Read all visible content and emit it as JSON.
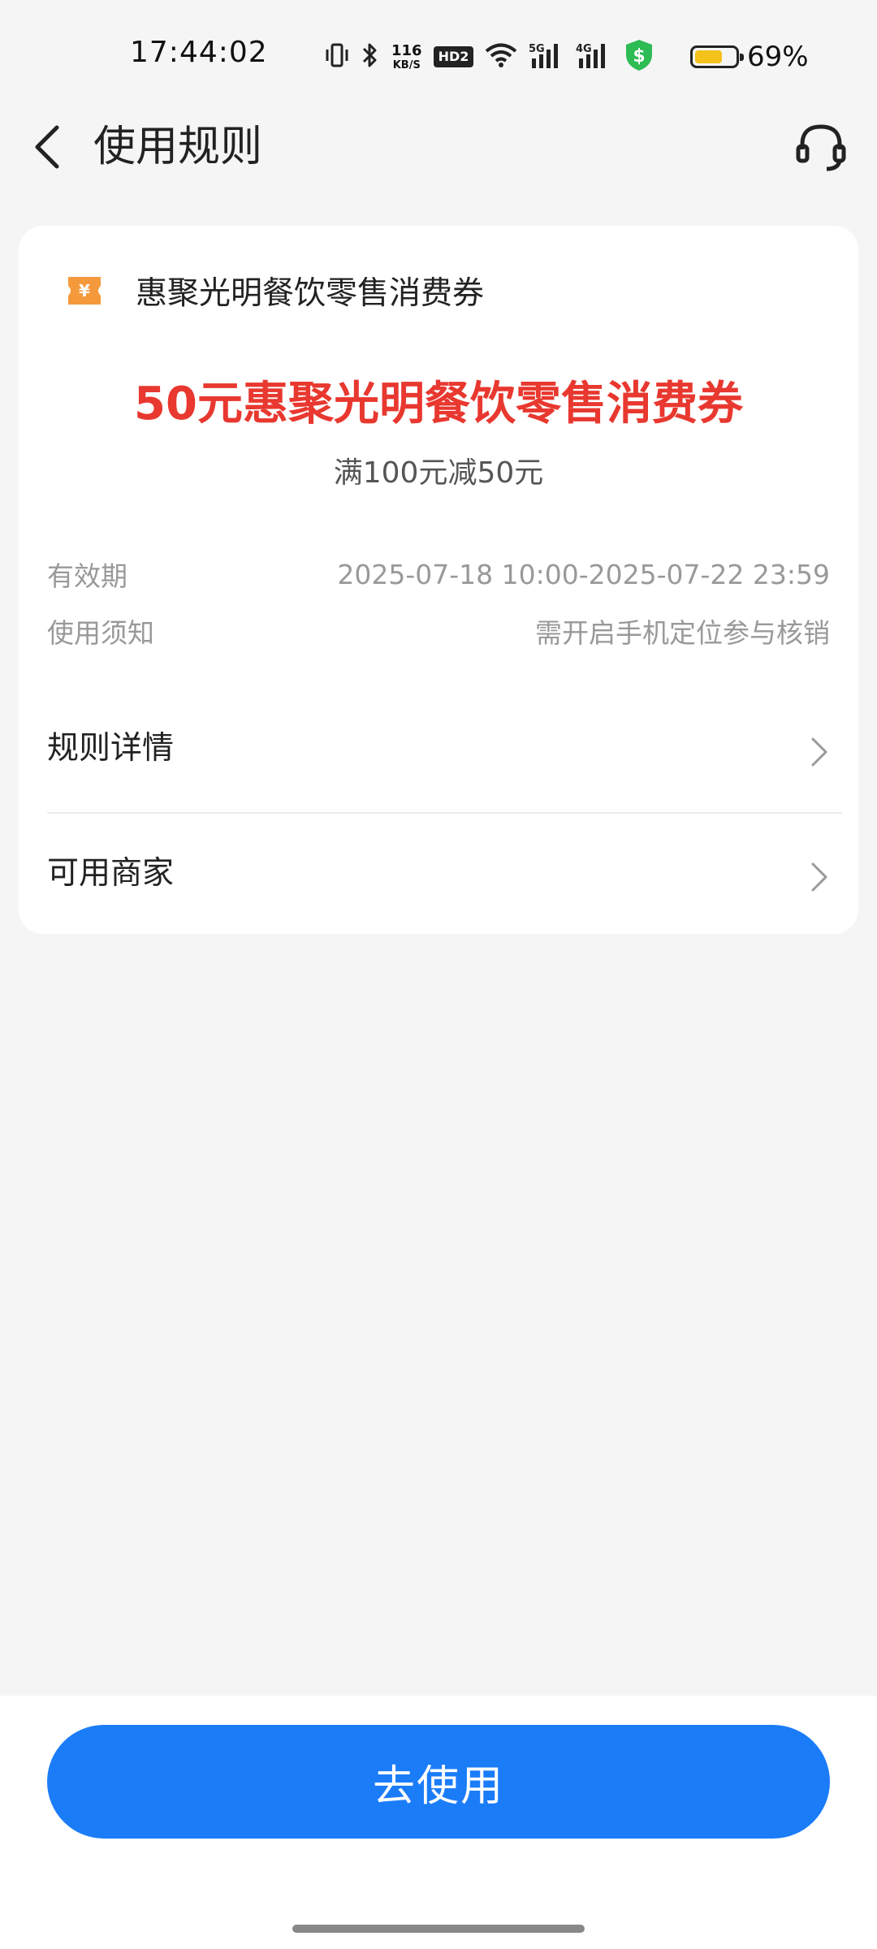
{
  "status_bar": {
    "time": "17:44:02",
    "net_speed_value": "116",
    "net_speed_unit": "KB/S",
    "hd_badge": "HD2",
    "battery_level": 0.69,
    "battery_text": "69%",
    "icons": [
      "vibrate-icon",
      "bluetooth-icon",
      "wifi-icon",
      "signal-5g-icon",
      "signal-4g-icon",
      "security-shield-icon",
      "battery-icon"
    ],
    "colors": {
      "shield": "#2dbb54",
      "battery_fill": "#f5c21b"
    }
  },
  "nav": {
    "title": "使用规则",
    "back_icon": "chevron-left-icon",
    "support_icon": "headset-icon"
  },
  "coupon": {
    "icon": "ticket-yen-icon",
    "name": "惠聚光明餐饮零售消费券",
    "title": "50元惠聚光明餐饮零售消费券",
    "condition": "满100元减50元",
    "title_color": "#e8382f",
    "icon_color": "#f59a3c"
  },
  "info": {
    "validity_label": "有效期",
    "validity_value": "2025-07-18 10:00-2025-07-22 23:59",
    "notice_label": "使用须知",
    "notice_value": "需开启手机定位参与核销"
  },
  "links": {
    "rules_label": "规则详情",
    "merchants_label": "可用商家"
  },
  "action": {
    "use_button": "去使用",
    "button_color": "#1b7cf8"
  }
}
